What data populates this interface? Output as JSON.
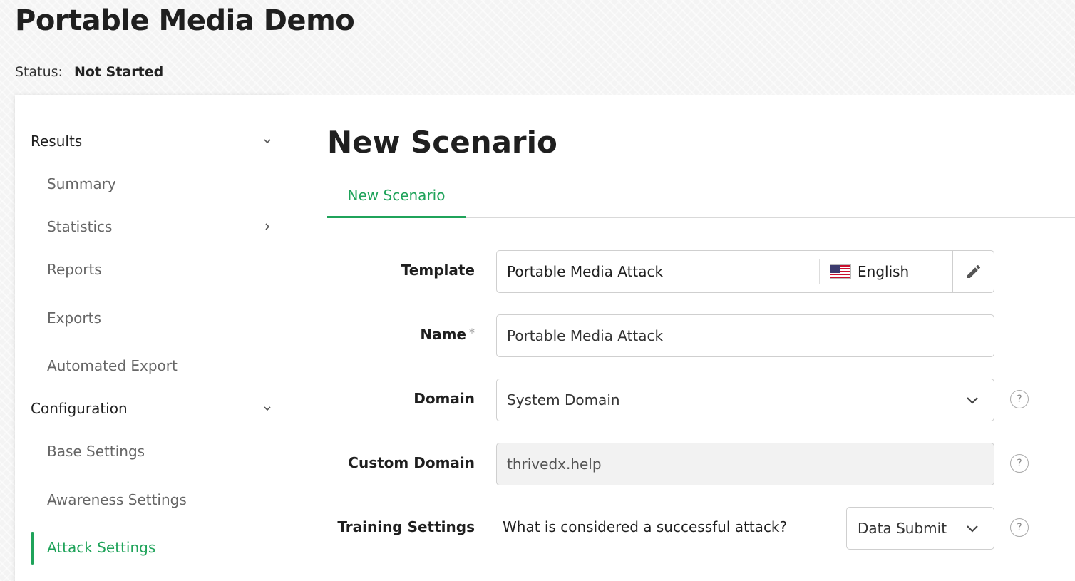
{
  "header": {
    "title": "Portable Media Demo",
    "status_label": "Status:",
    "status_value": "Not Started"
  },
  "sidebar": {
    "groups": [
      {
        "label": "Results",
        "items": [
          "Summary",
          "Statistics",
          "Reports",
          "Exports",
          "Automated Export"
        ]
      },
      {
        "label": "Configuration",
        "items": [
          "Base Settings",
          "Awareness Settings",
          "Attack Settings"
        ]
      }
    ],
    "active_item": "Attack Settings"
  },
  "main": {
    "title": "New Scenario",
    "tab_label": "New Scenario",
    "form": {
      "template": {
        "label": "Template",
        "value": "Portable Media Attack",
        "language": "English"
      },
      "name": {
        "label": "Name",
        "required_mark": "*",
        "value": "Portable Media Attack"
      },
      "domain": {
        "label": "Domain",
        "value": "System Domain"
      },
      "custom_domain": {
        "label": "Custom Domain",
        "value": "thrivedx.help"
      },
      "training": {
        "label": "Training Settings",
        "question": "What is considered a successful attack?",
        "value": "Data Submit"
      },
      "help_glyph": "?"
    }
  },
  "colors": {
    "accent": "#1fa35a"
  }
}
